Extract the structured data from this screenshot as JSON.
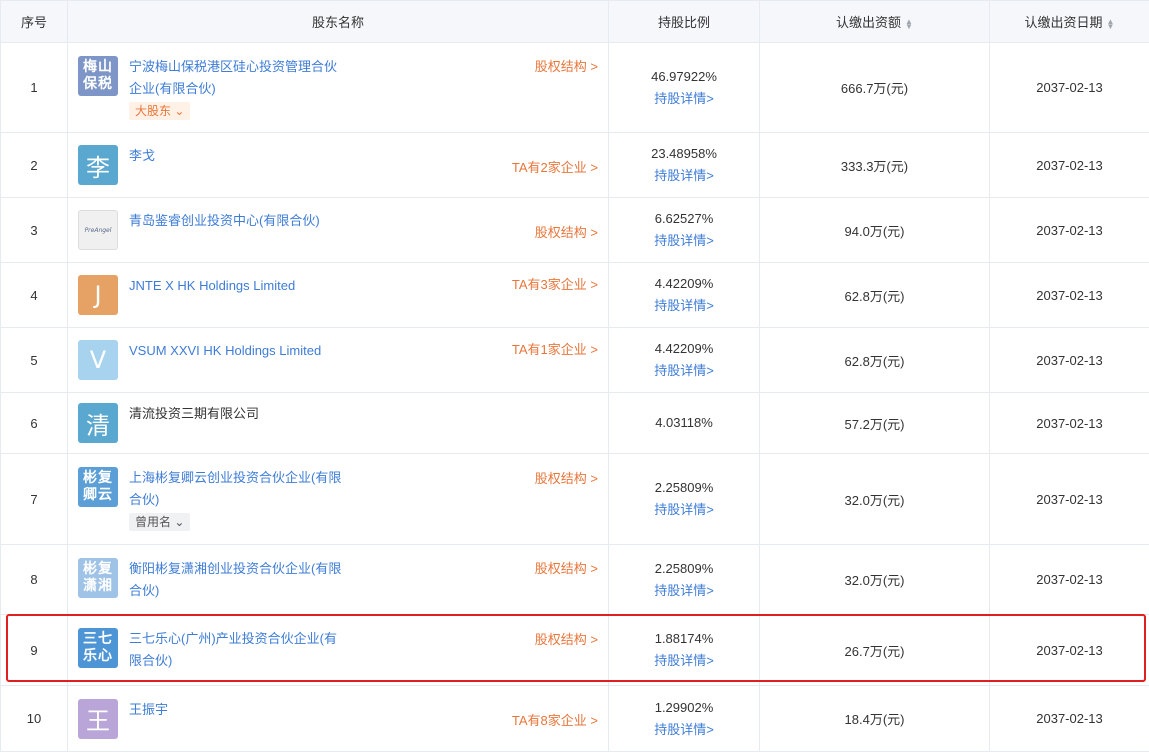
{
  "headers": {
    "seq": "序号",
    "name": "股东名称",
    "ratio": "持股比例",
    "capital": "认缴出资额",
    "date": "认缴出资日期"
  },
  "rows": [
    {
      "seq": "1",
      "logo": "梅山\n保税",
      "logo_color": "#7d96c7",
      "name": "宁波梅山保税港区硅心投资管理合伙企业(有限合伙)",
      "tag": "大股东",
      "right_link": "股权结构 >",
      "ratio": "46.97922%",
      "detail": "持股详情>",
      "capital": "666.7万(元)",
      "date": "2037-02-13"
    },
    {
      "seq": "2",
      "logo": "李",
      "logo_color": "#5aa8cf",
      "name": "李戈",
      "tag": "",
      "right_link": "TA有2家企业 >",
      "ratio": "23.48958%",
      "detail": "持股详情>",
      "capital": "333.3万(元)",
      "date": "2037-02-13"
    },
    {
      "seq": "3",
      "logo": "PreAngel",
      "logo_color": "#f0f0f0",
      "name": "青岛鉴睿创业投资中心(有限合伙)",
      "tag": "",
      "right_link": "股权结构 >",
      "ratio": "6.62527%",
      "detail": "持股详情>",
      "capital": "94.0万(元)",
      "date": "2037-02-13"
    },
    {
      "seq": "4",
      "logo": "J",
      "logo_color": "#e6a164",
      "name": "JNTE X HK Holdings Limited",
      "tag": "",
      "right_link": "TA有3家企业 >",
      "ratio": "4.42209%",
      "detail": "持股详情>",
      "capital": "62.8万(元)",
      "date": "2037-02-13"
    },
    {
      "seq": "5",
      "logo": "V",
      "logo_color": "#a7d3ef",
      "name": "VSUM XXVI HK Holdings Limited",
      "tag": "",
      "right_link": "TA有1家企业 >",
      "ratio": "4.42209%",
      "detail": "持股详情>",
      "capital": "62.8万(元)",
      "date": "2037-02-13"
    },
    {
      "seq": "6",
      "logo": "清",
      "logo_color": "#5aa8cf",
      "name": "清流投资三期有限公司",
      "tag": "",
      "right_link": "",
      "ratio": "4.03118%",
      "detail": "",
      "capital": "57.2万(元)",
      "date": "2037-02-13"
    },
    {
      "seq": "7",
      "logo": "彬复\n卿云",
      "logo_color": "#5b9fd6",
      "name": "上海彬复卿云创业投资合伙企业(有限合伙)",
      "tag": "曾用名",
      "right_link": "股权结构 >",
      "ratio": "2.25809%",
      "detail": "持股详情>",
      "capital": "32.0万(元)",
      "date": "2037-02-13"
    },
    {
      "seq": "8",
      "logo": "彬复\n潇湘",
      "logo_color": "#9fc3e6",
      "name": "衡阳彬复潇湘创业投资合伙企业(有限合伙)",
      "tag": "",
      "right_link": "股权结构 >",
      "ratio": "2.25809%",
      "detail": "持股详情>",
      "capital": "32.0万(元)",
      "date": "2037-02-13"
    },
    {
      "seq": "9",
      "logo": "三七\n乐心",
      "logo_color": "#4e95d6",
      "name": "三七乐心(广州)产业投资合伙企业(有限合伙)",
      "tag": "",
      "right_link": "股权结构 >",
      "ratio": "1.88174%",
      "detail": "持股详情>",
      "capital": "26.7万(元)",
      "date": "2037-02-13"
    },
    {
      "seq": "10",
      "logo": "王",
      "logo_color": "#b9a5d8",
      "name": "王振宇",
      "tag": "",
      "right_link": "TA有8家企业 >",
      "ratio": "1.29902%",
      "detail": "持股详情>",
      "capital": "18.4万(元)",
      "date": "2037-02-13"
    }
  ]
}
